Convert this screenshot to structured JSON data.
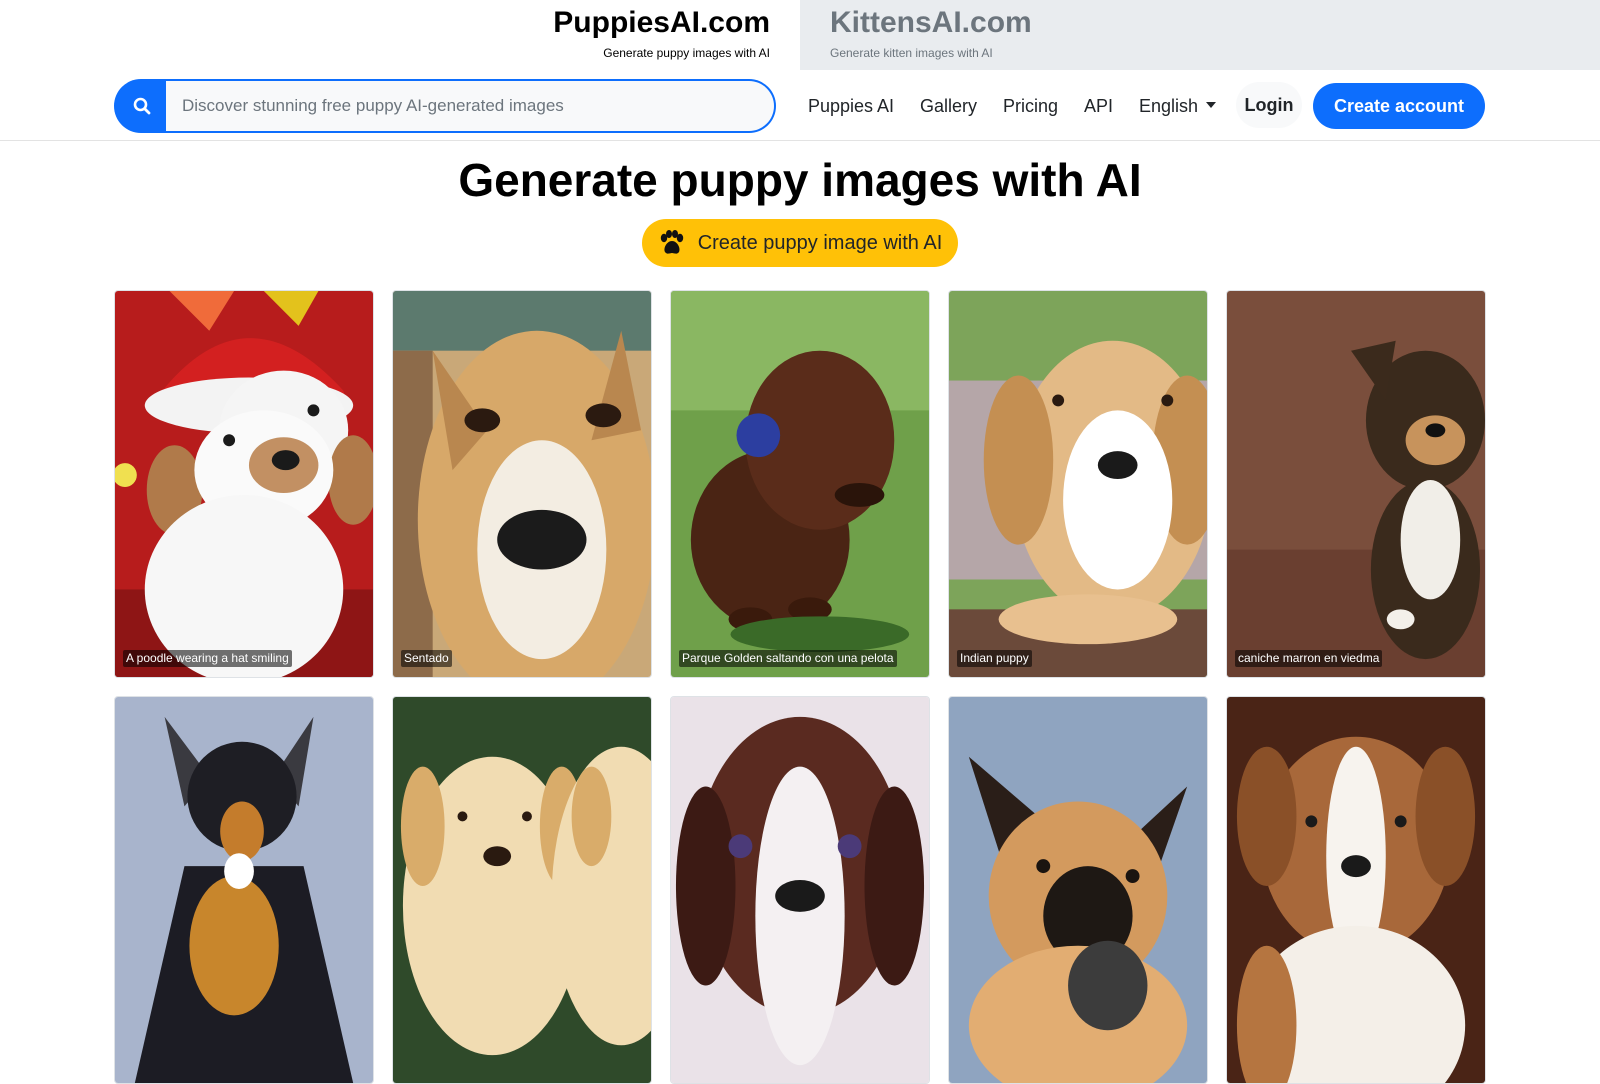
{
  "sites": {
    "active": {
      "name": "PuppiesAI.com",
      "tagline": "Generate puppy images with AI"
    },
    "other": {
      "name": "KittensAI.com",
      "tagline": "Generate kitten images with AI"
    }
  },
  "search": {
    "placeholder": "Discover stunning free puppy AI-generated images",
    "value": ""
  },
  "nav": {
    "links": [
      "Puppies AI",
      "Gallery",
      "Pricing",
      "API"
    ],
    "language": "English",
    "login": "Login",
    "create_account": "Create account"
  },
  "hero": {
    "title": "Generate puppy images with AI",
    "cta": "Create puppy image with AI"
  },
  "gallery": [
    {
      "caption": "A poodle wearing a hat smiling"
    },
    {
      "caption": "Sentado"
    },
    {
      "caption": "Parque Golden saltando con una pelota"
    },
    {
      "caption": "Indian puppy"
    },
    {
      "caption": "caniche marron en viedma"
    },
    {
      "caption": ""
    },
    {
      "caption": ""
    },
    {
      "caption": ""
    },
    {
      "caption": ""
    },
    {
      "caption": ""
    }
  ],
  "colors": {
    "primary": "#0d6efd",
    "cta": "#ffc107",
    "inactive_site_bg": "#e9ecef"
  },
  "icons": {
    "search": "search-icon",
    "paw": "paw-icon",
    "language_caret": "chevron-down-icon"
  }
}
